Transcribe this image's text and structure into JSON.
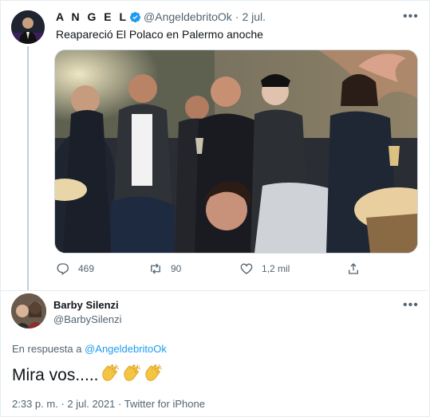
{
  "tweet": {
    "author_name": "A N G E L",
    "author_handle": "@AngeldebritoOk",
    "separator": "·",
    "date": "2 jul.",
    "text": "Reapareció El Polaco en Palermo anoche",
    "more_icon": "more-horizontal-icon",
    "actions": {
      "replies": "469",
      "retweets": "90",
      "likes": "1,2 mil"
    }
  },
  "reply": {
    "author_name": "Barby Silenzi",
    "author_handle": "@BarbySilenzi",
    "reply_prefix": "En respuesta a",
    "reply_mention": "@AngeldebritoOk",
    "text": "Mira vos.....",
    "emoji": "clapping-hands-icon",
    "time": "2:33 p. m.",
    "separator": "·",
    "date": "2 jul. 2021",
    "source": "Twitter for iPhone"
  },
  "colors": {
    "accent": "#1d9bf0",
    "secondary_text": "#536471",
    "clap": "#f4c542"
  }
}
